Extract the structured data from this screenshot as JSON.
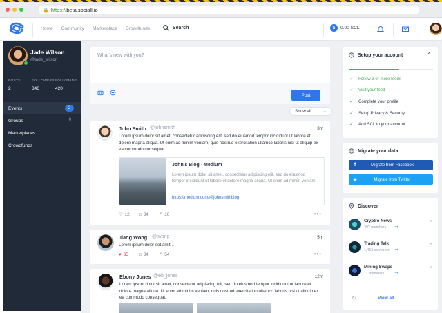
{
  "browser": {
    "url_protocol": "https://",
    "url_host": "beta.sociall.io"
  },
  "nav": {
    "links": [
      "Home",
      "Community",
      "Marketplace",
      "Crowdfunds"
    ],
    "search_label": "Search",
    "balance": "0.00 SCL",
    "coin_symbol": "$"
  },
  "profile": {
    "name": "Jade Wilson",
    "handle": "@jade_wilson",
    "stats": [
      {
        "label": "POSTS",
        "value": "2"
      },
      {
        "label": "FOLLOWERS",
        "value": "346"
      },
      {
        "label": "FOLLOWING",
        "value": "420"
      }
    ]
  },
  "menu": [
    {
      "label": "Events",
      "badge": "2"
    },
    {
      "label": "Groups",
      "count": "0"
    },
    {
      "label": "Marketplaces"
    },
    {
      "label": "Crowdfunds"
    }
  ],
  "composer": {
    "placeholder": "What's new with you?",
    "post_label": "Post"
  },
  "feed_filter": "Show all",
  "posts": [
    {
      "name": "John Smith",
      "handle": "@johnsmith",
      "time": "3m",
      "text": "Lorem ipsum dolor sit amet, consectetur adipiscing elit, sed do eiusmod tempor incididunt ut labore et dolore magna aliqua. Ut enim ad minim veniam, quis nostrud exercitation ullamco laboris nisi ut aliquip ex ea commodo consequat.",
      "link": {
        "title": "John's Blog - Medium",
        "desc": "Lorem ipsum dolor sit amet, consectetur adipiscing elit, sed do eiusmod tempor incididunt ut labore et dolore magna aliqua. Ut enim ad minim veniam.",
        "url": "https://medium.com/@johnsmithblog"
      },
      "likes": "12",
      "comments": "34",
      "shares": "10"
    },
    {
      "name": "Jiang Wong",
      "handle": "@jwong",
      "time": "5m",
      "text": "Lorem ipsum dolor set amit...",
      "likes": "35",
      "comments": "34",
      "shares": "54",
      "liked_color": "#e0344b"
    },
    {
      "name": "Ebony Jones",
      "handle": "@eb_jones",
      "time": "12m",
      "text": "Lorem ipsum dolor sit amet, consectetur adipiscing elit, sed do eiusmod tempor incididunt ut labore et dolore magna aliqua. Ut enim ad minim veniam, quis nostrud exercitation ullamco laboris nisi ut aliquip ex ea commodo consequat."
    }
  ],
  "setup": {
    "title": "Setup your account",
    "progress": 0.6,
    "items": [
      {
        "label": "Follow 3 or more feeds",
        "done": true
      },
      {
        "label": "Visit your feed",
        "done": true
      },
      {
        "label": "Complete your profile",
        "done": false
      },
      {
        "label": "Setup Privacy & Security",
        "done": false
      },
      {
        "label": "Add SCL to your account",
        "done": false
      }
    ]
  },
  "migrate": {
    "title": "Migrate your data",
    "facebook": "Migrate from Facebook",
    "twitter": "Migrate from Twitter",
    "facebook_color": "#1f5bb5",
    "twitter_color": "#1da1f2"
  },
  "discover": {
    "title": "Discover",
    "items": [
      {
        "name": "Cryptro News",
        "members": "392 members"
      },
      {
        "name": "Trading Talk",
        "members": "1,453 members"
      },
      {
        "name": "Mining Swaps",
        "members": "71 members"
      }
    ],
    "view_all": "View all"
  },
  "colors": {
    "accent": "#2f76e8",
    "sidebar": "#212a38",
    "success": "#46b25c"
  }
}
